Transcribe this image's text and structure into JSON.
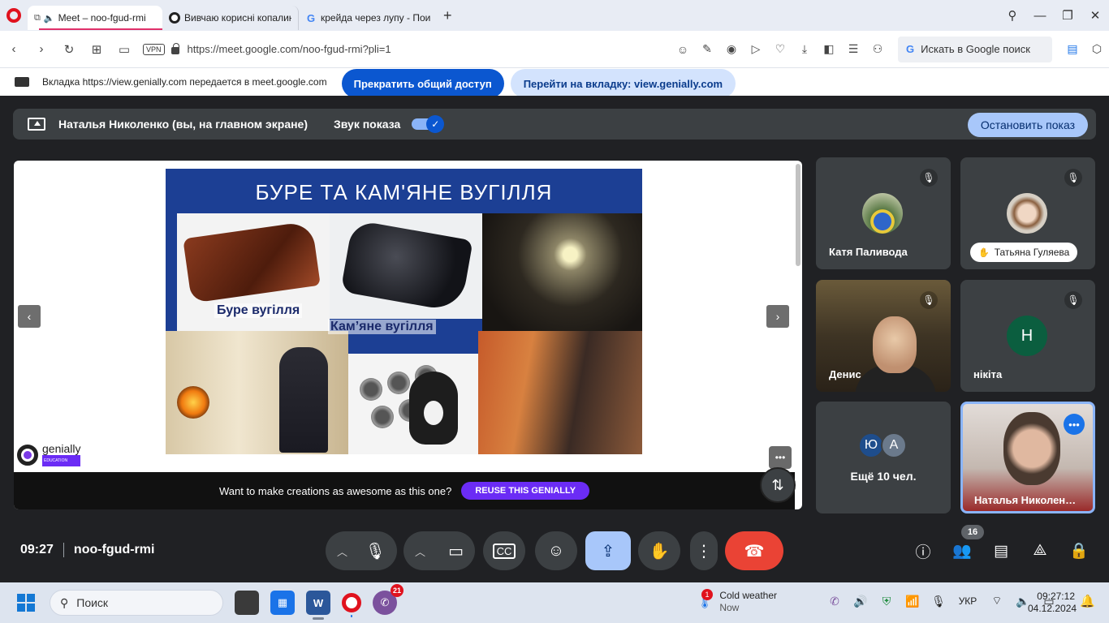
{
  "browser": {
    "tabs": [
      {
        "title": "Meet – noo-fgud-rmi",
        "icon": "meet-icon"
      },
      {
        "title": "Вивчаю корисні копалин",
        "icon": "genially-icon"
      },
      {
        "title": "крейда через лупу - Пои",
        "icon": "google-icon"
      }
    ],
    "new_tab": "+",
    "vpn_label": "VPN",
    "url": "https://meet.google.com/noo-fgud-rmi?pli=1",
    "search_placeholder": "Искать в Google поиск",
    "search_g": "G"
  },
  "share_banner": {
    "text": "Вкладка https://view.genially.com передается в meet.google.com",
    "stop_label": "Прекратить общий доступ",
    "goto_label": "Перейти на вкладку: view.genially.com"
  },
  "meet": {
    "presenter_text": "Наталья Николенко (вы, на главном экране)",
    "sound_label": "Звук показа",
    "stop_show_label": "Остановить показ",
    "slide": {
      "title": "БУРЕ ТА КАМ'ЯНЕ ВУГІЛЛЯ",
      "caption_brown": "Буре вугілля",
      "caption_black": "Кам’яне вугілля"
    },
    "genially_logo": "genially",
    "genially_sub": "EDUCATION",
    "promo_text": "Want to make creations as awesome as this one?",
    "promo_button": "REUSE THIS GENIALLY",
    "participants": [
      {
        "name": "Катя Паливода"
      },
      {
        "name": "Татьяна Гуляева"
      },
      {
        "name": "Денис"
      },
      {
        "name": "нікіта",
        "initial": "Н"
      }
    ],
    "more": {
      "initials": [
        "Ю",
        "А"
      ],
      "label": "Ещё 10 чел."
    },
    "self_name": "Наталья Николен…",
    "time": "09:27",
    "meeting_code": "noo-fgud-rmi",
    "participants_count": "16",
    "accent_colors": {
      "hangup": "#ea4335",
      "share_active": "#a8c7fa",
      "primary": "#0b57d0"
    }
  },
  "taskbar": {
    "search_label": "Поиск",
    "viber_badge": "21",
    "weather_badge": "1",
    "weather_title": "Cold weather",
    "weather_sub": "Now",
    "lang": "УКР",
    "clock_time": "09:27:12",
    "clock_date": "04.12.2024"
  }
}
